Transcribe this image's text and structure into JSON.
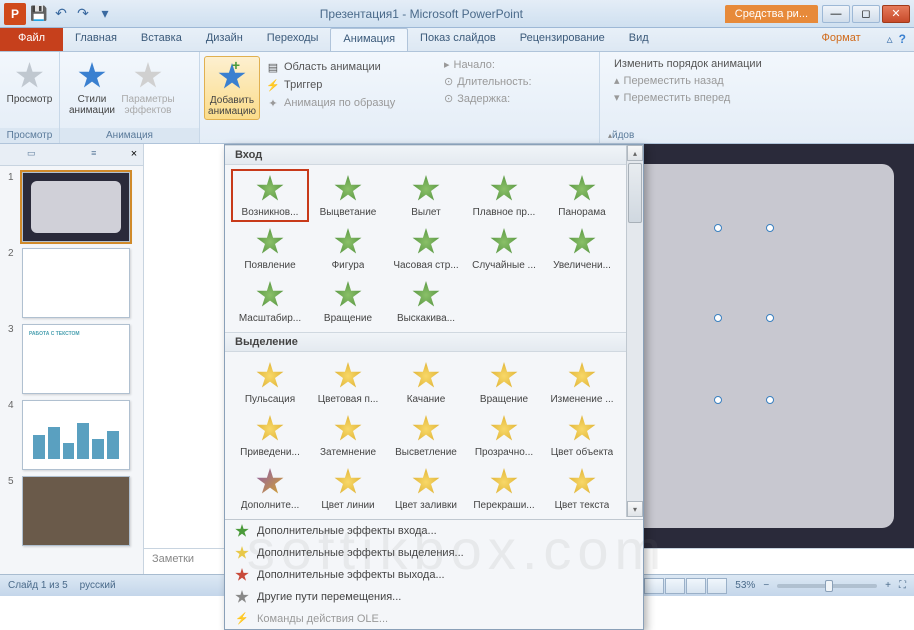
{
  "titlebar": {
    "title": "Презентация1 - Microsoft PowerPoint",
    "context_tab": "Средства ри..."
  },
  "tabs": {
    "file": "Файл",
    "items": [
      "Главная",
      "Вставка",
      "Дизайн",
      "Переходы",
      "Анимация",
      "Показ слайдов",
      "Рецензирование",
      "Вид"
    ],
    "active_index": 4,
    "format": "Формат"
  },
  "ribbon": {
    "preview": {
      "btn": "Просмотр",
      "group": "Просмотр"
    },
    "animation": {
      "styles": "Стили\nанимации",
      "params": "Параметры\nэффектов",
      "group": "Анимация"
    },
    "advanced": {
      "add": "Добавить\nанимацию",
      "pane": "Область анимации",
      "trigger": "Триггер",
      "painter": "Анимация по образцу"
    },
    "timing": {
      "start": "Начало:",
      "duration": "Длительность:",
      "delay": "Задержка:"
    },
    "reorder": {
      "title": "Изменить порядок анимации",
      "back": "Переместить назад",
      "fwd": "Переместить вперед"
    },
    "slides_suffix": "йдов"
  },
  "gallery": {
    "section1": "Вход",
    "entrance": [
      {
        "label": "Возникнов...",
        "sel": true
      },
      {
        "label": "Выцветание"
      },
      {
        "label": "Вылет"
      },
      {
        "label": "Плавное пр..."
      },
      {
        "label": "Панорама"
      },
      {
        "label": "Появление"
      },
      {
        "label": "Фигура"
      },
      {
        "label": "Часовая стр..."
      },
      {
        "label": "Случайные ..."
      },
      {
        "label": "Увеличени..."
      },
      {
        "label": "Масштабир..."
      },
      {
        "label": "Вращение"
      },
      {
        "label": "Выскакива..."
      }
    ],
    "section2": "Выделение",
    "emphasis": [
      {
        "label": "Пульсация"
      },
      {
        "label": "Цветовая п..."
      },
      {
        "label": "Качание"
      },
      {
        "label": "Вращение"
      },
      {
        "label": "Изменение ..."
      },
      {
        "label": "Приведени..."
      },
      {
        "label": "Затемнение"
      },
      {
        "label": "Высветление"
      },
      {
        "label": "Прозрачно..."
      },
      {
        "label": "Цвет объекта"
      },
      {
        "label": "Дополните...",
        "cls": "blend"
      },
      {
        "label": "Цвет линии"
      },
      {
        "label": "Цвет заливки"
      },
      {
        "label": "Перекраши..."
      },
      {
        "label": "Цвет текста"
      }
    ],
    "more": {
      "m1": "Дополнительные эффекты входа...",
      "m2": "Дополнительные эффекты выделения...",
      "m3": "Дополнительные эффекты выхода...",
      "m4": "Другие пути перемещения...",
      "m5": "Команды действия OLE..."
    }
  },
  "thumbs": [
    "1",
    "2",
    "3",
    "4",
    "5"
  ],
  "notes": "Заметки",
  "status": {
    "left": "Слайд 1 из 5",
    "lang": "русский",
    "zoom": "53%"
  },
  "watermark": "softikbox.com",
  "t3_title": "РАБОТА С ТЕКСТОМ"
}
